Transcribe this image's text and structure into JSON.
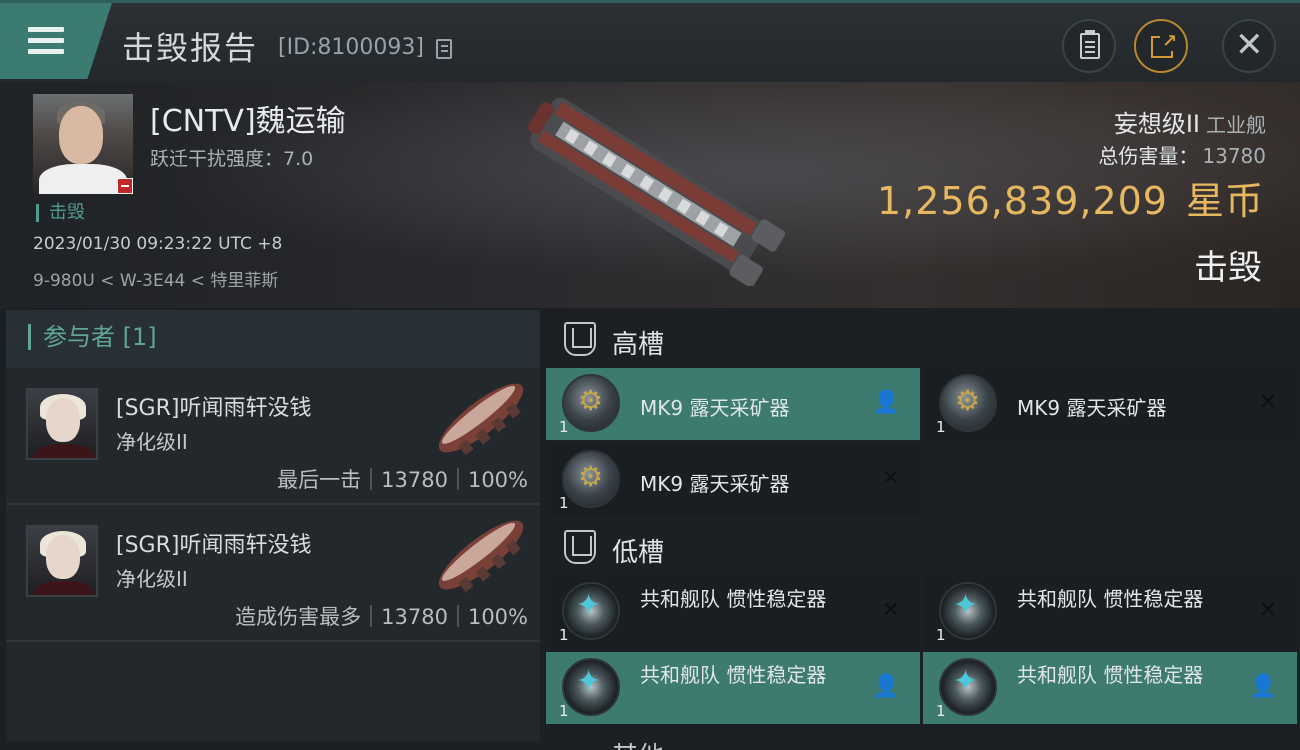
{
  "header": {
    "title": "击毁报告",
    "report_id": "[ID:8100093]"
  },
  "victim": {
    "name": "[CNTV]魏运输",
    "warp_strength": "跃迁干扰强度：7.0",
    "status": "击毁",
    "timestamp": "2023/01/30 09:23:22 UTC +8",
    "location": "9-980U < W-3E44 < 特里菲斯",
    "ship_class": "妄想级II",
    "ship_type": "工业舰",
    "total_damage_label": "总伤害量：",
    "total_damage": "13780",
    "isk_value": "1,256,839,209",
    "isk_unit": "星币",
    "result": "击毁"
  },
  "participants": {
    "header": "参与者 [1]",
    "rows": [
      {
        "name": "[SGR]听闻雨轩没钱",
        "ship": "净化级II",
        "role": "最后一击",
        "damage": "13780",
        "percent": "100%"
      },
      {
        "name": "[SGR]听闻雨轩没钱",
        "ship": "净化级II",
        "role": "造成伤害最多",
        "damage": "13780",
        "percent": "100%"
      }
    ]
  },
  "fitting": {
    "high_slot_label": "高槽",
    "low_slot_label": "低槽",
    "next_slot_label": "其他",
    "high_slots": [
      {
        "name": "MK9 露天采矿器",
        "qty": "1",
        "state": "dropped",
        "icon": "miner"
      },
      {
        "name": "MK9 露天采矿器",
        "qty": "1",
        "state": "destroyed",
        "icon": "miner"
      },
      {
        "name": "MK9 露天采矿器",
        "qty": "1",
        "state": "destroyed",
        "icon": "miner"
      }
    ],
    "low_slots": [
      {
        "name": "共和舰队 惯性稳定器",
        "qty": "1",
        "state": "destroyed",
        "icon": "stabilizer"
      },
      {
        "name": "共和舰队 惯性稳定器",
        "qty": "1",
        "state": "destroyed",
        "icon": "stabilizer"
      },
      {
        "name": "共和舰队 惯性稳定器",
        "qty": "1",
        "state": "dropped",
        "icon": "stabilizer"
      },
      {
        "name": "共和舰队 惯性稳定器",
        "qty": "1",
        "state": "dropped",
        "icon": "stabilizer"
      }
    ]
  },
  "colors": {
    "accent_teal": "#3d7a70",
    "isk_gold": "#e8b860",
    "destroyed_badge": "#c0282a"
  }
}
